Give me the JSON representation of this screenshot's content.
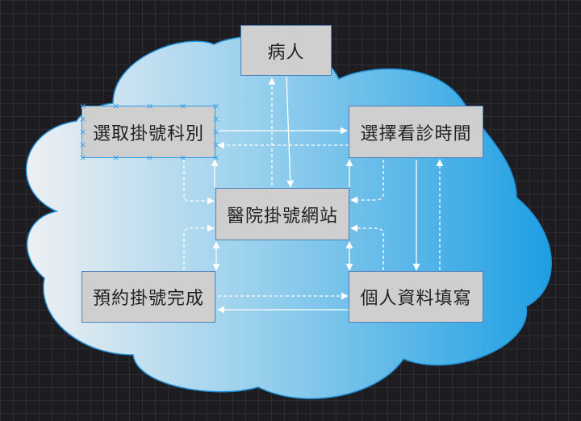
{
  "diagram": {
    "nodes": {
      "patient": "病人",
      "select_department": "選取掛號科別",
      "select_time": "選擇看診時間",
      "hospital_site": "醫院掛號網站",
      "booking_complete": "預約掛號完成",
      "fill_personal_info": "個人資料填寫"
    }
  },
  "colors": {
    "canvas_bg": "#1d1c21",
    "grid": "#2e2d33",
    "cloud_light": "#eef0f2",
    "cloud_dark": "#1e9fe3",
    "cloud_stroke": "#1f8fd6",
    "node_fill": "#cfcfcf",
    "node_border": "#4a7fb8",
    "arrow": "#ffffff",
    "selection": "#36a2f0"
  }
}
